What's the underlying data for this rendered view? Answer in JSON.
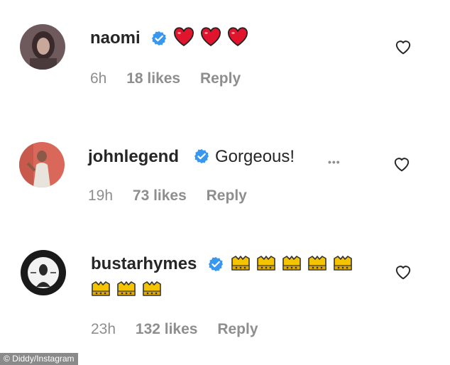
{
  "comments": [
    {
      "username": "naomi",
      "text": "",
      "emoji": "heart",
      "emoji_count": 3,
      "time": "6h",
      "likes": "18 likes",
      "reply": "Reply"
    },
    {
      "username": "johnlegend",
      "text": "Gorgeous!",
      "time": "19h",
      "likes": "73 likes",
      "reply": "Reply",
      "more": "•••"
    },
    {
      "username": "bustarhymes",
      "text": "",
      "emoji": "crown",
      "emoji_count": 8,
      "time": "23h",
      "likes": "132 likes",
      "reply": "Reply"
    }
  ],
  "credit": "© Diddy/Instagram",
  "colors": {
    "text": "#262626",
    "meta": "#8e8e8e",
    "verified": "#3897f0",
    "heart": "#e0142c",
    "crown": "#f5c400"
  }
}
